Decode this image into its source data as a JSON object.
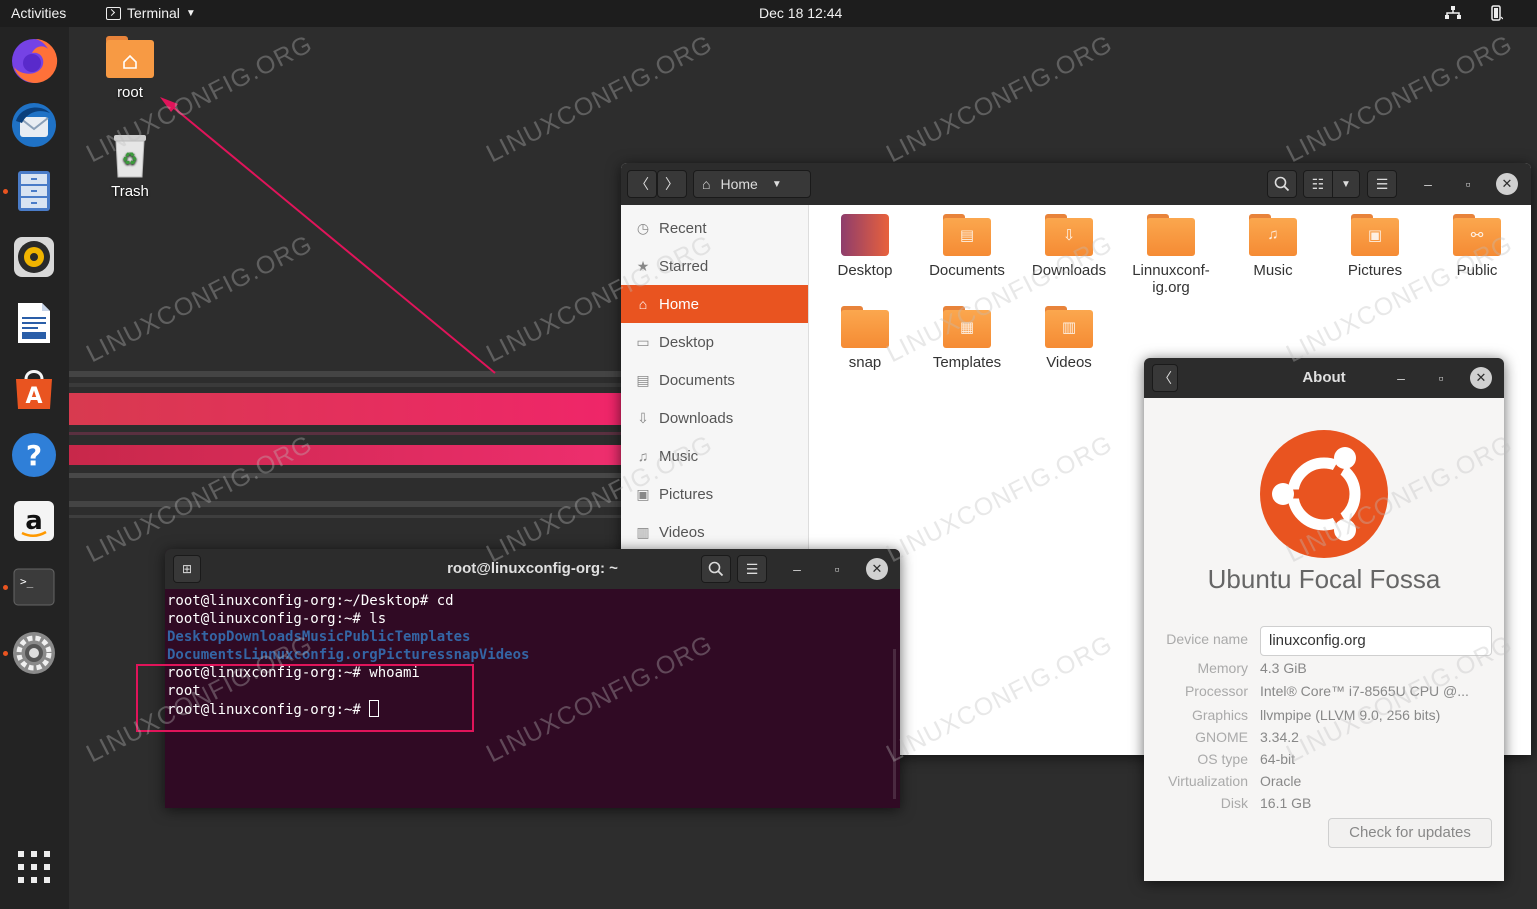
{
  "topbar": {
    "activities": "Activities",
    "app_menu": "Terminal",
    "clock": "Dec 18  12:44"
  },
  "dock": {
    "items": [
      "firefox-icon",
      "thunderbird-icon",
      "files-icon",
      "rhythmbox-icon",
      "writer-icon",
      "software-icon",
      "help-icon",
      "amazon-icon",
      "terminal-icon",
      "settings-icon"
    ],
    "show_apps": "show-applications-icon"
  },
  "desktop": {
    "icons": [
      {
        "label": "root",
        "icon": "home-folder-icon"
      },
      {
        "label": "Trash",
        "icon": "trash-icon"
      }
    ]
  },
  "watermark": "LINUXCONFIG.ORG",
  "files": {
    "location": "Home",
    "sidebar": [
      {
        "label": "Recent",
        "icon": "clock-icon"
      },
      {
        "label": "Starred",
        "icon": "star-icon"
      },
      {
        "label": "Home",
        "icon": "home-icon",
        "active": true
      },
      {
        "label": "Desktop",
        "icon": "desktop-icon"
      },
      {
        "label": "Documents",
        "icon": "document-icon"
      },
      {
        "label": "Downloads",
        "icon": "download-icon"
      },
      {
        "label": "Music",
        "icon": "music-icon"
      },
      {
        "label": "Pictures",
        "icon": "picture-icon"
      },
      {
        "label": "Videos",
        "icon": "video-icon"
      }
    ],
    "folders": [
      {
        "label": "Desktop"
      },
      {
        "label": "Documents"
      },
      {
        "label": "Downloads"
      },
      {
        "label": "Linnuxconf-ig.org"
      },
      {
        "label": "Music"
      },
      {
        "label": "Pictures"
      },
      {
        "label": "Public"
      },
      {
        "label": "snap"
      },
      {
        "label": "Templates"
      },
      {
        "label": "Videos"
      }
    ]
  },
  "terminal": {
    "title": "root@linuxconfig-org: ~",
    "lines": [
      "root@linuxconfig-org:~/Desktop# cd",
      "root@linuxconfig-org:~# ls"
    ],
    "ls_row1": [
      "Desktop",
      "Downloads",
      "Music",
      "Public",
      "Templates"
    ],
    "ls_row2": [
      "Documents",
      "Linnuxconfig.org",
      "Pictures",
      "snap",
      "Videos"
    ],
    "lines_after": [
      "root@linuxconfig-org:~# whoami",
      "root"
    ],
    "prompt": "root@linuxconfig-org:~# "
  },
  "about": {
    "title": "About",
    "os_name": "Ubuntu Focal Fossa",
    "device_name_label": "Device name",
    "device_name_value": "linuxconfig.org",
    "rows": [
      {
        "label": "Memory",
        "value": "4.3 GiB"
      },
      {
        "label": "Processor",
        "value": "Intel® Core™ i7-8565U CPU @..."
      },
      {
        "label": "Graphics",
        "value": "llvmpipe (LLVM 9.0, 256 bits)"
      },
      {
        "label": "GNOME",
        "value": "3.34.2"
      },
      {
        "label": "OS type",
        "value": "64-bit"
      },
      {
        "label": "Virtualization",
        "value": "Oracle"
      },
      {
        "label": "Disk",
        "value": "16.1 GB"
      }
    ],
    "check_updates": "Check for updates"
  },
  "colors": {
    "ubuntu_orange": "#e95420",
    "terminal_bg": "#300a24",
    "highlight": "#e0145a"
  }
}
